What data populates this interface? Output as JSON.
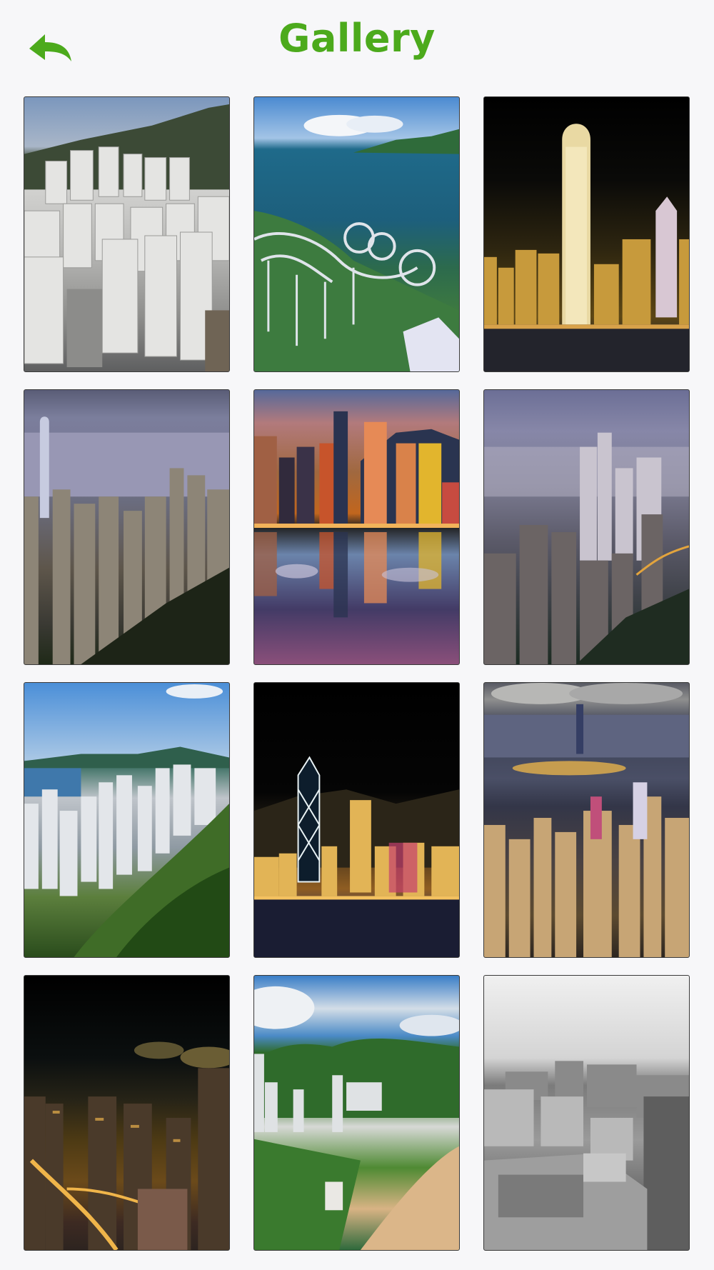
{
  "header": {
    "title": "Gallery",
    "back_icon": "back-arrow-icon",
    "accent_color": "#4caa1c"
  },
  "gallery": {
    "photos": [
      {
        "subject": "residential-towers-day"
      },
      {
        "subject": "roller-coaster-sea"
      },
      {
        "subject": "night-ifc-tower"
      },
      {
        "subject": "dusk-skyline-peak"
      },
      {
        "subject": "sunset-reflection"
      },
      {
        "subject": "misty-night-skyline"
      },
      {
        "subject": "day-hillside-city"
      },
      {
        "subject": "night-bank-tower"
      },
      {
        "subject": "night-harbour-clouds"
      },
      {
        "subject": "night-streets-above"
      },
      {
        "subject": "beach-mountains"
      },
      {
        "subject": "bw-rooftops"
      }
    ]
  }
}
